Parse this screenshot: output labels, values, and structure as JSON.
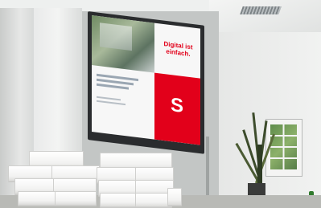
{
  "screen": {
    "headline": "Digital ist einfach.",
    "logo_glyph": "S",
    "brand_red": "#e2001a"
  },
  "image": {
    "description_tags": [
      "presentation screen",
      "stacked white boxes",
      "office meeting room",
      "plant",
      "framed picture"
    ]
  }
}
